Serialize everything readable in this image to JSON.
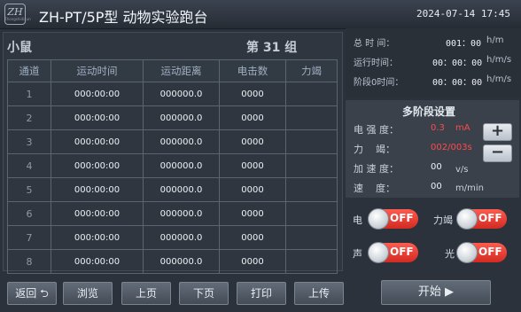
{
  "header": {
    "logo_text": "ZH",
    "logo_sub": "Zhongshidixun",
    "title": "ZH-PT/5P型 动物实验跑台",
    "datetime": "2024-07-14  17:45"
  },
  "subject": {
    "animal": "小鼠",
    "group": "第 31 组"
  },
  "table": {
    "columns": [
      "通道",
      "运动时间",
      "运动距离",
      "电击数",
      "力竭"
    ],
    "rows": [
      [
        "1",
        "000:00:00",
        "000000.0",
        "0000",
        ""
      ],
      [
        "2",
        "000:00:00",
        "000000.0",
        "0000",
        ""
      ],
      [
        "3",
        "000:00:00",
        "000000.0",
        "0000",
        ""
      ],
      [
        "4",
        "000:00:00",
        "000000.0",
        "0000",
        ""
      ],
      [
        "5",
        "000:00:00",
        "000000.0",
        "0000",
        ""
      ],
      [
        "6",
        "000:00:00",
        "000000.0",
        "0000",
        ""
      ],
      [
        "7",
        "000:00:00",
        "000000.0",
        "0000",
        ""
      ],
      [
        "8",
        "000:00:00",
        "000000.0",
        "0000",
        ""
      ]
    ]
  },
  "buttons": {
    "back": "返回",
    "back_icon": "⮌",
    "browse": "浏览",
    "prev": "上页",
    "next": "下页",
    "print": "打印",
    "upload": "上传",
    "start": "开始 ▶"
  },
  "stats": {
    "total_time_label": "总 时 间：",
    "total_time_value": "001：00",
    "total_time_unit": "h/m",
    "run_time_label": "运行时间：",
    "run_time_value": "00：00：00",
    "run_time_unit": "h/m/s",
    "stage_time_label": "阶段0时间：",
    "stage_time_value": "00：00：00",
    "stage_time_unit": "h/m/s"
  },
  "multistage": {
    "title": "多阶段设置",
    "intensity_label": "电 强 度：",
    "intensity_value": "0.3",
    "intensity_unit": "mA",
    "exhaustion_label": "力    竭：",
    "exhaustion_value": "002/003s",
    "accel_label": "加 速 度：",
    "accel_value": "00",
    "accel_unit": "v/s",
    "speed_label": "速    度：",
    "speed_value": "00",
    "speed_unit": "m/min",
    "plus": "+",
    "minus": "−"
  },
  "toggles": {
    "electric_label": "电",
    "electric_state": "OFF",
    "exhaust_label": "力竭",
    "exhaust_state": "OFF",
    "sound_label": "声",
    "sound_state": "OFF",
    "light_label": "光",
    "light_state": "OFF"
  },
  "colors": {
    "accent_red": "#ff4a4a",
    "toggle_off": "#e23a30",
    "background": "#2b323b"
  }
}
